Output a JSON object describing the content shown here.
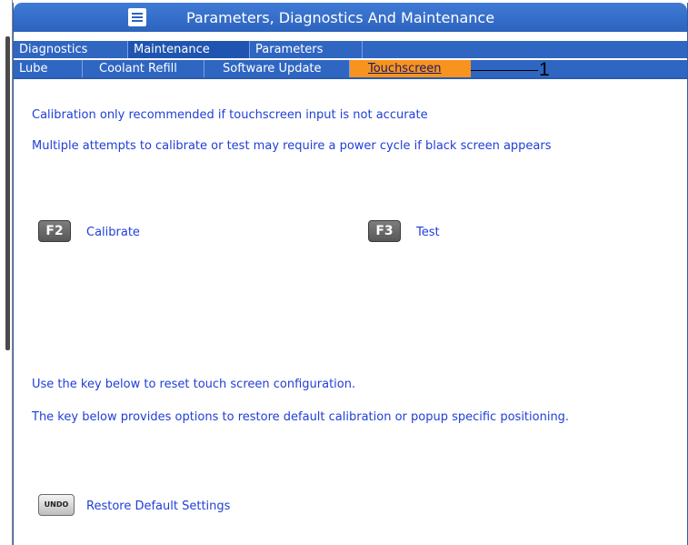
{
  "window": {
    "title": "Parameters, Diagnostics And Maintenance",
    "menu_icon": "hamburger-menu-icon"
  },
  "tabs_primary": [
    {
      "label": "Diagnostics",
      "active": false
    },
    {
      "label": "Maintenance",
      "active": true
    },
    {
      "label": "Parameters",
      "active": false
    }
  ],
  "tabs_secondary": [
    {
      "label": "Lube",
      "active": false
    },
    {
      "label": "Coolant Refill",
      "active": false
    },
    {
      "label": "Software Update",
      "active": false
    },
    {
      "label": "Touchscreen",
      "active": true
    }
  ],
  "callout": {
    "number": "1"
  },
  "content": {
    "note1": "Calibration only recommended if touchscreen input is not accurate",
    "note2": "Multiple attempts to calibrate or test may require a power cycle if black screen appears",
    "calibrate": {
      "key": "F2",
      "label": "Calibrate"
    },
    "test": {
      "key": "F3",
      "label": "Test"
    },
    "reset_note1": "Use the key below to reset touch screen configuration.",
    "reset_note2": "The key below provides options to restore default calibration or popup specific positioning.",
    "restore": {
      "key": "UNDO",
      "label": "Restore Default Settings"
    }
  },
  "colors": {
    "titlebar": "#2d63be",
    "active_tab": "#f7931e",
    "text": "#1f3fd8"
  }
}
